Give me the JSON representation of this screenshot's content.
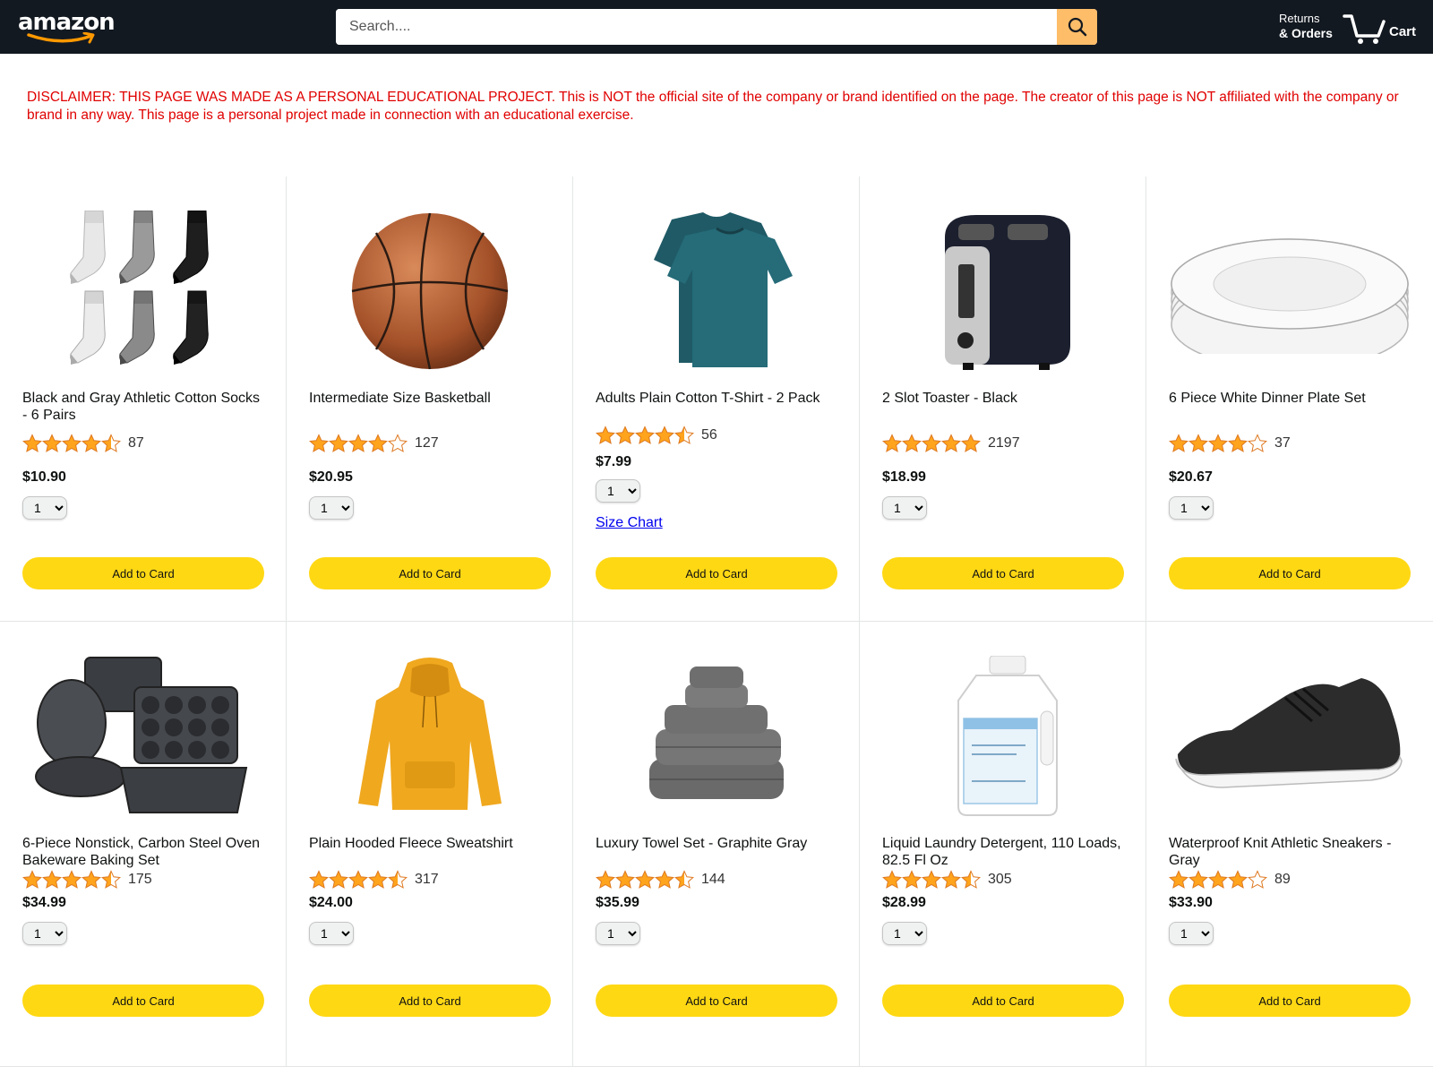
{
  "header": {
    "logo_text": "amazon",
    "search_placeholder": "Search....",
    "returns_line1": "Returns",
    "returns_line2": "& Orders",
    "cart_count": "",
    "cart_label": "Cart"
  },
  "disclaimer": "DISCLAIMER: THIS PAGE WAS MADE AS A PERSONAL EDUCATIONAL PROJECT. This is NOT the official site of the company or brand identified on the page. The creator of this page is NOT affiliated with the company or brand in any way. This page is a personal project made in connection with an educational exercise.",
  "colors": {
    "header_bg": "#131921",
    "search_button": "#febd69",
    "add_button": "#ffd814",
    "star": "#ffa41c",
    "disclaimer_text": "#e00000"
  },
  "products": [
    {
      "name": "Black and Gray Athletic Cotton Socks - 6 Pairs",
      "rating": 4.5,
      "rating_count": "87",
      "price": "$10.90",
      "qty": "1",
      "button": "Add to Card",
      "icon": "socks-image"
    },
    {
      "name": "Intermediate Size Basketball",
      "rating": 4.0,
      "rating_count": "127",
      "price": "$20.95",
      "qty": "1",
      "button": "Add to Card",
      "icon": "basketball-image"
    },
    {
      "name": "Adults Plain Cotton T-Shirt - 2 Pack",
      "rating": 4.5,
      "rating_count": "56",
      "price": "$7.99",
      "qty": "1",
      "button": "Add to Card",
      "link": "Size Chart",
      "icon": "tshirt-image"
    },
    {
      "name": "2 Slot Toaster - Black",
      "rating": 5.0,
      "rating_count": "2197",
      "price": "$18.99",
      "qty": "1",
      "button": "Add to Card",
      "icon": "toaster-image"
    },
    {
      "name": "6 Piece White Dinner Plate Set",
      "rating": 4.0,
      "rating_count": "37",
      "price": "$20.67",
      "qty": "1",
      "button": "Add to Card",
      "icon": "plates-image"
    },
    {
      "name": "6-Piece Nonstick, Carbon Steel Oven Bakeware Baking Set",
      "rating": 4.5,
      "rating_count": "175",
      "price": "$34.99",
      "qty": "1",
      "button": "Add to Card",
      "icon": "bakeware-image"
    },
    {
      "name": "Plain Hooded Fleece Sweatshirt",
      "rating": 4.5,
      "rating_count": "317",
      "price": "$24.00",
      "qty": "1",
      "button": "Add to Card",
      "icon": "hoodie-image"
    },
    {
      "name": "Luxury Towel Set - Graphite Gray",
      "rating": 4.5,
      "rating_count": "144",
      "price": "$35.99",
      "qty": "1",
      "button": "Add to Card",
      "icon": "towels-image"
    },
    {
      "name": "Liquid Laundry Detergent, 110 Loads, 82.5 Fl Oz",
      "rating": 4.5,
      "rating_count": "305",
      "price": "$28.99",
      "qty": "1",
      "button": "Add to Card",
      "icon": "detergent-image"
    },
    {
      "name": "Waterproof Knit Athletic Sneakers - Gray",
      "rating": 4.0,
      "rating_count": "89",
      "price": "$33.90",
      "qty": "1",
      "button": "Add to Card",
      "icon": "sneakers-image"
    }
  ]
}
